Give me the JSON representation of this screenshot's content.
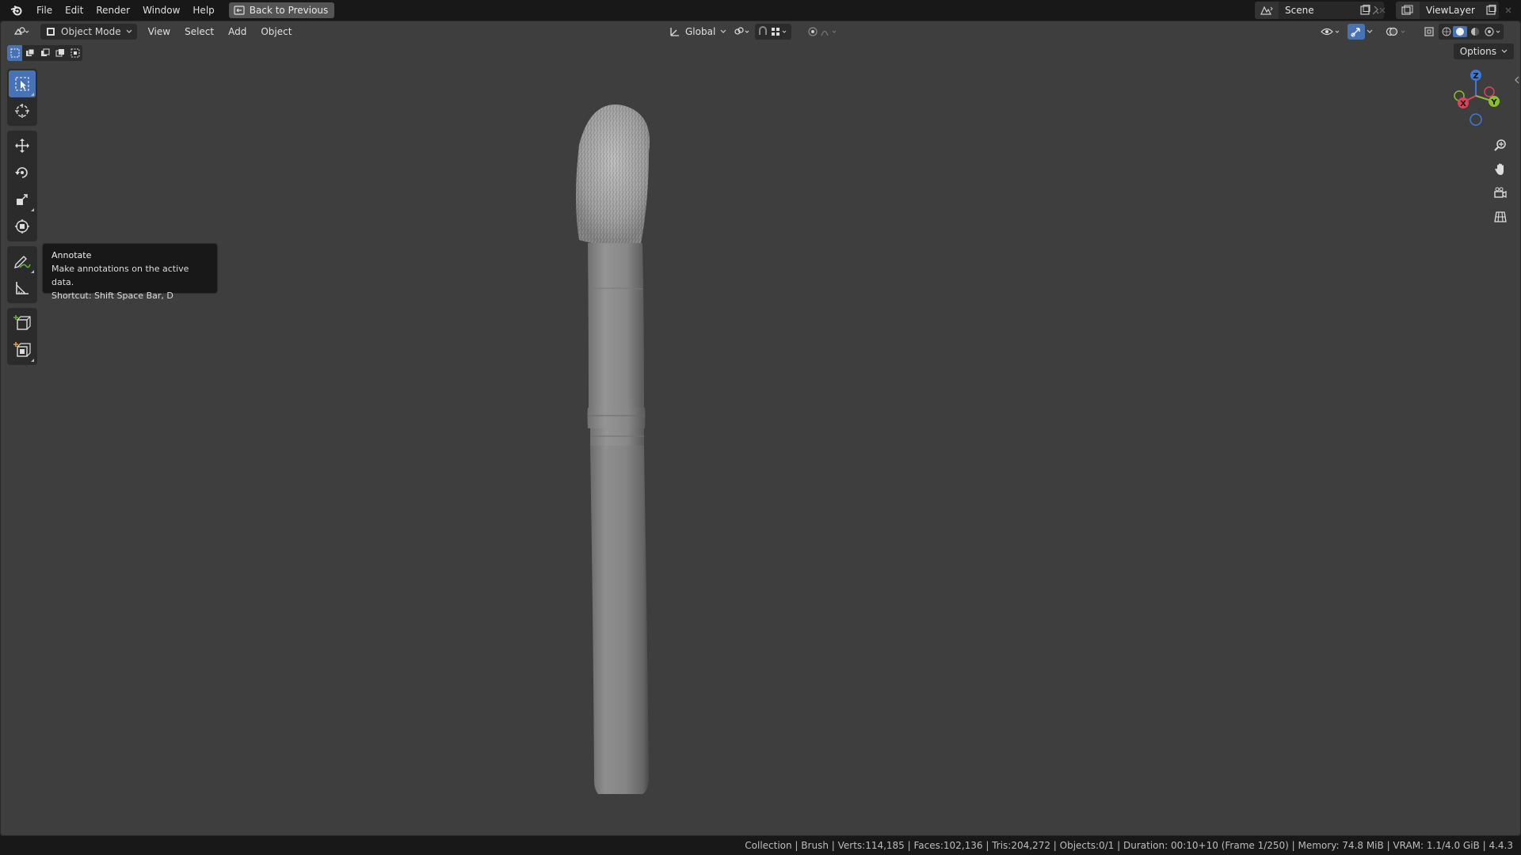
{
  "menu": {
    "items": [
      "File",
      "Edit",
      "Render",
      "Window",
      "Help"
    ],
    "back_button": "Back to Previous"
  },
  "workspace": {
    "scene_name": "Scene",
    "view_layer_name": "ViewLayer"
  },
  "viewport_header": {
    "mode": "Object Mode",
    "menus": [
      "View",
      "Select",
      "Add",
      "Object"
    ],
    "orientation": "Global",
    "options_label": "Options"
  },
  "tooltip": {
    "title": "Annotate",
    "description": "Make annotations on the active data.",
    "shortcut": "Shortcut: Shift Space Bar, D"
  },
  "gizmo": {
    "x": "X",
    "y": "Y",
    "z": "Z"
  },
  "status": {
    "text": "Collection | Brush | Verts:114,185 | Faces:102,136 | Tris:204,272 | Objects:0/1 | Duration: 00:10+10 (Frame 1/250) | Memory: 74.8 MiB | VRAM: 1.1/4.0 GiB | 4.4.3"
  },
  "colors": {
    "accent": "#4772b3",
    "viewport_bg": "#3e3e3e",
    "axis_x": "#e0415a",
    "axis_y": "#8cbf2a",
    "axis_z": "#3b7bd6"
  },
  "icons": {
    "logo": "blender-logo-icon",
    "tools": [
      "select-box-icon",
      "cursor-icon",
      "move-icon",
      "rotate-icon",
      "scale-icon",
      "transform-icon",
      "annotate-icon",
      "measure-icon",
      "add-cube-icon",
      "add-primitive-icon"
    ],
    "nav": [
      "zoom-icon",
      "pan-hand-icon",
      "camera-icon",
      "grid-ortho-icon"
    ]
  }
}
